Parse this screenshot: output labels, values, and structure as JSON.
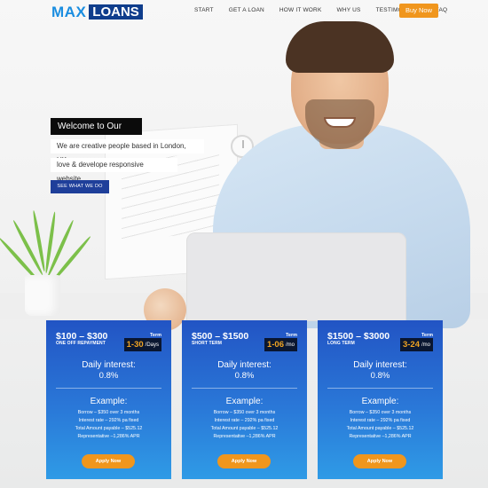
{
  "header": {
    "logo_max": "MAX",
    "logo_loans": "LOANS",
    "nav": [
      "START",
      "GET A LOAN",
      "HOW IT WORK",
      "WHY US",
      "TESTIMONIALS",
      "FAQ"
    ],
    "buy_now": "Buy Now"
  },
  "hero": {
    "welcome": "Welcome to Our Site",
    "line1": "We are creative people based in London, UK,",
    "line2": "love & develope responsive website.",
    "see_button": "SEE WHAT WE DO"
  },
  "cards": [
    {
      "range": "$100 – $300",
      "subtitle": "ONE OFF REPAYMENT",
      "term_label": "Term",
      "term_value": "1-30",
      "term_unit": "/Days",
      "daily_interest_label": "Daily interest:",
      "daily_interest_value": "0.8%",
      "example_title": "Example:",
      "example_lines": [
        "Borrow – $350 over 3 months",
        "Interest rate – 292% pa fixed",
        "Total Amount payable – $525.12",
        "Representative –1,286% APR"
      ],
      "apply": "Apply Now"
    },
    {
      "range": "$500 – $1500",
      "subtitle": "SHORT TERM",
      "term_label": "Term",
      "term_value": "1-06",
      "term_unit": "/mo",
      "daily_interest_label": "Daily interest:",
      "daily_interest_value": "0.8%",
      "example_title": "Example:",
      "example_lines": [
        "Borrow – $350 over 3 months",
        "Interest rate – 292% pa fixed",
        "Total Amount payable – $525.12",
        "Representative –1,286% APR"
      ],
      "apply": "Apply Now"
    },
    {
      "range": "$1500 – $3000",
      "subtitle": "LONG TERM",
      "term_label": "Term",
      "term_value": "3-24",
      "term_unit": "/mo",
      "daily_interest_label": "Daily interest:",
      "daily_interest_value": "0.8%",
      "example_title": "Example:",
      "example_lines": [
        "Borrow – $350 over 3 months",
        "Interest rate – 292% pa fixed",
        "Total Amount payable – $525.12",
        "Representative –1,286% APR"
      ],
      "apply": "Apply Now"
    }
  ],
  "colors": {
    "brand_blue": "#1a8de0",
    "logo_dark": "#0f3d8c",
    "accent_orange": "#f0961d",
    "card_top": "#2254c4",
    "card_bottom": "#2f9be6"
  }
}
